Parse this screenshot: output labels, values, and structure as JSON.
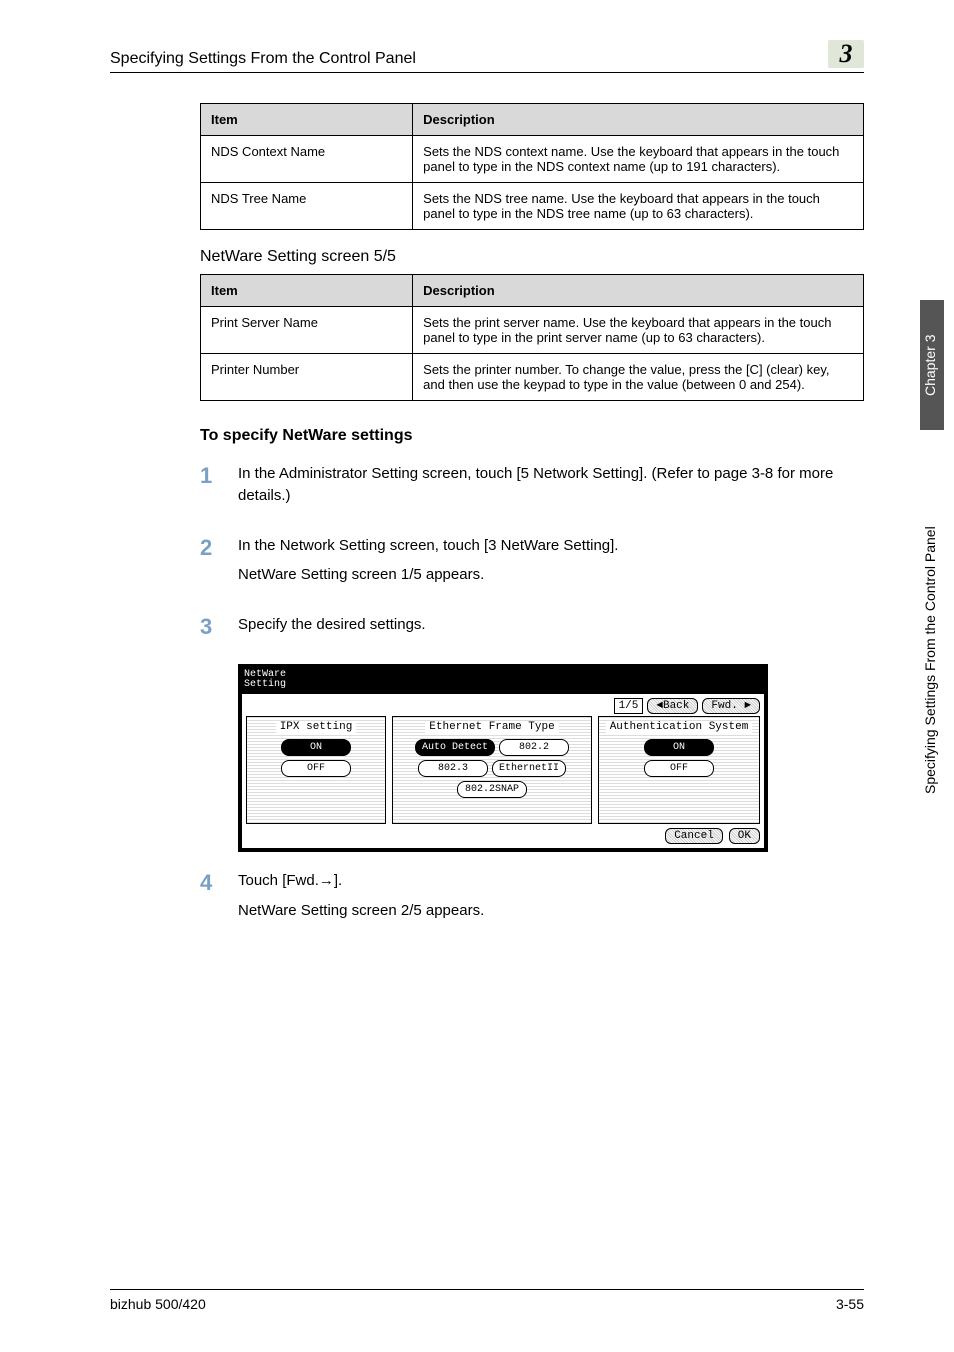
{
  "header": {
    "section_title": "Specifying Settings From the Control Panel",
    "chapter_badge": "3"
  },
  "sidetab": {
    "chapter": "Chapter 3",
    "title": "Specifying Settings From the Control Panel"
  },
  "table1": {
    "headers": {
      "item": "Item",
      "desc": "Description"
    },
    "rows": [
      {
        "item": "NDS Context Name",
        "desc": "Sets the NDS context name. Use the keyboard that appears in the touch panel to type in the NDS context name (up to 191 characters)."
      },
      {
        "item": "NDS Tree Name",
        "desc": "Sets the NDS tree name. Use the keyboard that appears in the touch panel to type in the NDS tree name (up to 63 characters)."
      }
    ]
  },
  "subhead1": "NetWare Setting screen 5/5",
  "table2": {
    "headers": {
      "item": "Item",
      "desc": "Description"
    },
    "rows": [
      {
        "item": "Print Server Name",
        "desc": "Sets the print server name. Use the keyboard that appears in the touch panel to type in the print server name (up to 63 characters)."
      },
      {
        "item": "Printer Number",
        "desc": "Sets the printer number. To change the value, press the [C] (clear) key, and then use the keypad to type in the value (between 0 and 254)."
      }
    ]
  },
  "heading2": "To specify NetWare settings",
  "steps": [
    {
      "num": "1",
      "lines": [
        "In the Administrator Setting screen, touch [5 Network Setting]. (Refer to page 3-8 for more details.)"
      ]
    },
    {
      "num": "2",
      "lines": [
        "In the Network Setting screen, touch [3 NetWare Setting].",
        "NetWare Setting screen 1/5 appears."
      ]
    },
    {
      "num": "3",
      "lines": [
        "Specify the desired settings."
      ]
    },
    {
      "num": "4",
      "lines": [
        "Touch [Fwd.→].",
        "NetWare Setting screen 2/5 appears."
      ]
    }
  ],
  "screenshot": {
    "title_l1": "NetWare",
    "title_l2": "Setting",
    "page": "1/5",
    "back": "◄Back",
    "fwd": "Fwd. ►",
    "col1_label": "IPX setting",
    "col2_label": "Ethernet Frame Type",
    "col3_label": "Authentication System",
    "on": "ON",
    "off": "OFF",
    "auto_detect": "Auto Detect",
    "f8022": "802.2",
    "f8023": "802.3",
    "eth2": "EthernetII",
    "snap": "802.2SNAP",
    "cancel": "Cancel",
    "ok": "OK"
  },
  "footer": {
    "left": "bizhub 500/420",
    "right": "3-55"
  }
}
